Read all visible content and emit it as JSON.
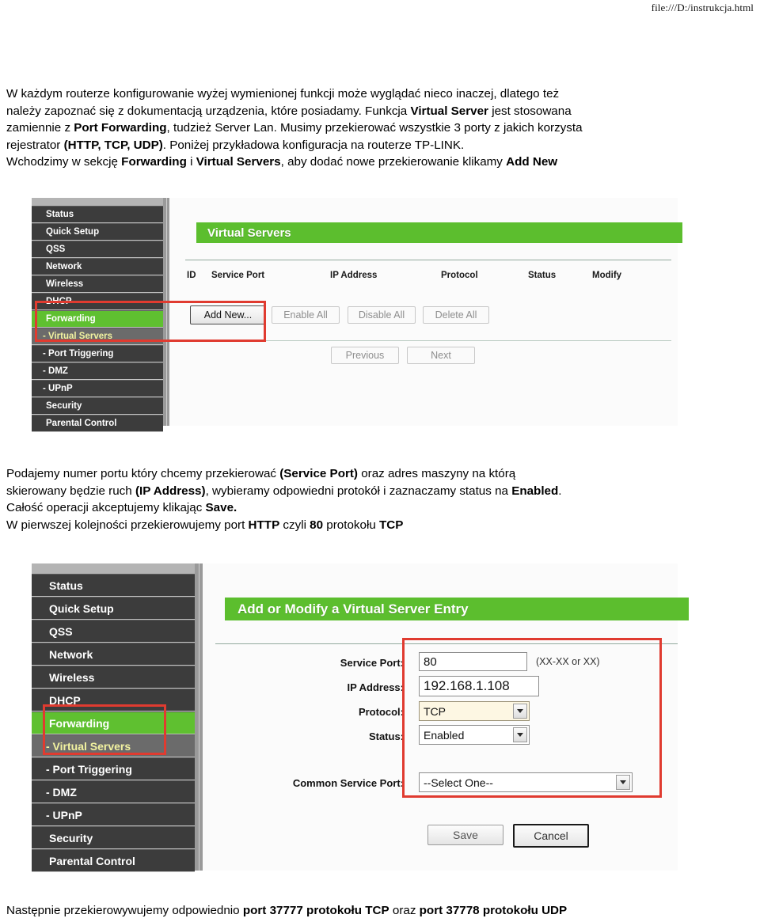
{
  "header": {
    "url": "file:///D:/instrukcja.html"
  },
  "intro_paragraph": {
    "line1_a": "W każdym routerze konfigurowanie wyżej wymienionej funkcji może wyglądać nieco inaczej, dlatego też",
    "line2_a": "należy zapoznać się z dokumentacją urządzenia, które posiadamy. Funkcja ",
    "line2_b": "Virtual Server",
    "line2_c": " jest stosowana",
    "line3_a": "zamiennie z ",
    "line3_b": "Port Forwarding",
    "line3_c": ", tudzież Server Lan. Musimy przekierować wszystkie 3 porty z jakich korzysta",
    "line4_a": "rejestrator ",
    "line4_b": "(HTTP, TCP, UDP)",
    "line4_c": ". Poniżej przykładowa konfiguracja na routerze TP-LINK.",
    "line5_a": "Wchodzimy w sekcję ",
    "line5_b": "Forwarding",
    "line5_c": " i ",
    "line5_d": "Virtual Servers",
    "line5_e": ", aby dodać nowe przekierowanie klikamy ",
    "line5_f": "Add New"
  },
  "middle_paragraph": {
    "line1_a": "Podajemy numer portu który chcemy przekierować ",
    "line1_b": "(Service Port)",
    "line1_c": " oraz adres maszyny na którą",
    "line2_a": "skierowany będzie ruch ",
    "line2_b": "(IP Address)",
    "line2_c": ", wybieramy odpowiedni protokół i zaznaczamy status na ",
    "line2_d": "Enabled",
    "line2_e": ".",
    "line3_a": "Całość operacji akceptujemy klikając ",
    "line3_b": "Save.",
    "line4_a": "W pierwszej kolejności przekierowujemy port ",
    "line4_b": "HTTP",
    "line4_c": " czyli ",
    "line4_d": "80",
    "line4_e": " protokołu ",
    "line4_f": "TCP"
  },
  "bottom_paragraph": {
    "a": "Następnie przekierowywujemy odpowiednio ",
    "b": "port 37777 protokołu TCP",
    "c": " oraz ",
    "d": "port 37778 protokołu UDP"
  },
  "colors": {
    "accent_green": "#5cbe2e",
    "sidebar_item": "#3c3c3c",
    "annotation_red": "#e03b30",
    "select_yellow": "#fdf7e3"
  },
  "screenshot1": {
    "sidebar": {
      "items": [
        {
          "label": "Status",
          "type": "top",
          "state": "normal"
        },
        {
          "label": "Quick Setup",
          "type": "top",
          "state": "normal"
        },
        {
          "label": "QSS",
          "type": "top",
          "state": "normal"
        },
        {
          "label": "Network",
          "type": "top",
          "state": "normal"
        },
        {
          "label": "Wireless",
          "type": "top",
          "state": "normal"
        },
        {
          "label": "DHCP",
          "type": "top",
          "state": "normal"
        },
        {
          "label": "Forwarding",
          "type": "top",
          "state": "active"
        },
        {
          "label": "- Virtual Servers",
          "type": "sub",
          "state": "active-sub"
        },
        {
          "label": "- Port Triggering",
          "type": "sub",
          "state": "normal"
        },
        {
          "label": "- DMZ",
          "type": "sub",
          "state": "normal"
        },
        {
          "label": "- UPnP",
          "type": "sub",
          "state": "normal"
        },
        {
          "label": "Security",
          "type": "top",
          "state": "normal"
        },
        {
          "label": "Parental Control",
          "type": "top",
          "state": "normal"
        }
      ]
    },
    "panel_title": "Virtual Servers",
    "table_headers": [
      "ID",
      "Service Port",
      "IP Address",
      "Protocol",
      "Status",
      "Modify"
    ],
    "table_rows": [],
    "buttons": {
      "add_new": "Add New...",
      "enable_all": "Enable All",
      "disable_all": "Disable All",
      "delete_all": "Delete All",
      "previous": "Previous",
      "next": "Next"
    }
  },
  "screenshot2": {
    "sidebar": {
      "items": [
        {
          "label": "Status",
          "type": "top",
          "state": "normal"
        },
        {
          "label": "Quick Setup",
          "type": "top",
          "state": "normal"
        },
        {
          "label": "QSS",
          "type": "top",
          "state": "normal"
        },
        {
          "label": "Network",
          "type": "top",
          "state": "normal"
        },
        {
          "label": "Wireless",
          "type": "top",
          "state": "normal"
        },
        {
          "label": "DHCP",
          "type": "top",
          "state": "normal"
        },
        {
          "label": "Forwarding",
          "type": "top",
          "state": "active"
        },
        {
          "label": "- Virtual Servers",
          "type": "sub",
          "state": "active-sub"
        },
        {
          "label": "- Port Triggering",
          "type": "sub",
          "state": "normal"
        },
        {
          "label": "- DMZ",
          "type": "sub",
          "state": "normal"
        },
        {
          "label": "- UPnP",
          "type": "sub",
          "state": "normal"
        },
        {
          "label": "Security",
          "type": "top",
          "state": "normal"
        },
        {
          "label": "Parental Control",
          "type": "top",
          "state": "normal"
        }
      ]
    },
    "panel_title": "Add or Modify a Virtual Server Entry",
    "form": {
      "service_port": {
        "label": "Service Port:",
        "value": "80",
        "hint": "(XX-XX or XX)"
      },
      "ip_address": {
        "label": "IP Address:",
        "value": "192.168.1.108"
      },
      "protocol": {
        "label": "Protocol:",
        "value": "TCP"
      },
      "status": {
        "label": "Status:",
        "value": "Enabled"
      },
      "common_port": {
        "label": "Common Service Port:",
        "value": "--Select One--"
      }
    },
    "buttons": {
      "save": "Save",
      "cancel": "Cancel"
    }
  }
}
